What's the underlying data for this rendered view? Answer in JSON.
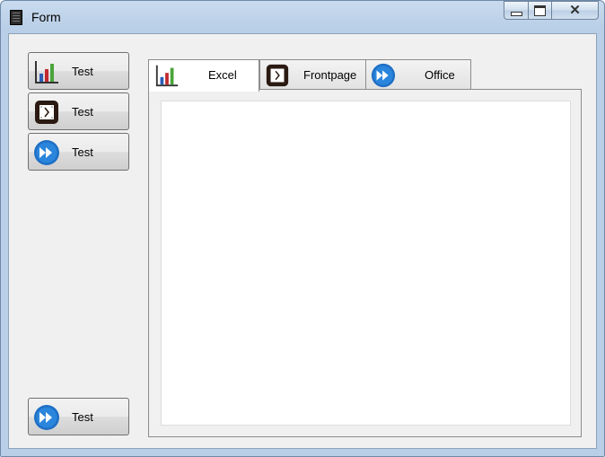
{
  "window": {
    "title": "Form"
  },
  "sidebar": {
    "buttons": [
      {
        "label": "Test",
        "icon": "bar-chart-icon"
      },
      {
        "label": "Test",
        "icon": "clock-icon"
      },
      {
        "label": "Test",
        "icon": "fast-forward-icon"
      },
      {
        "label": "Test",
        "icon": "fast-forward-icon"
      }
    ]
  },
  "tabs": [
    {
      "label": "Excel",
      "icon": "bar-chart-icon",
      "active": true
    },
    {
      "label": "Frontpage",
      "icon": "clock-icon",
      "active": false
    },
    {
      "label": "Office",
      "icon": "fast-forward-icon",
      "active": false
    }
  ],
  "colors": {
    "accent_blue": "#1f6fc4",
    "window_frame": "#b9cfe7",
    "client_bg": "#f0f0f0"
  }
}
